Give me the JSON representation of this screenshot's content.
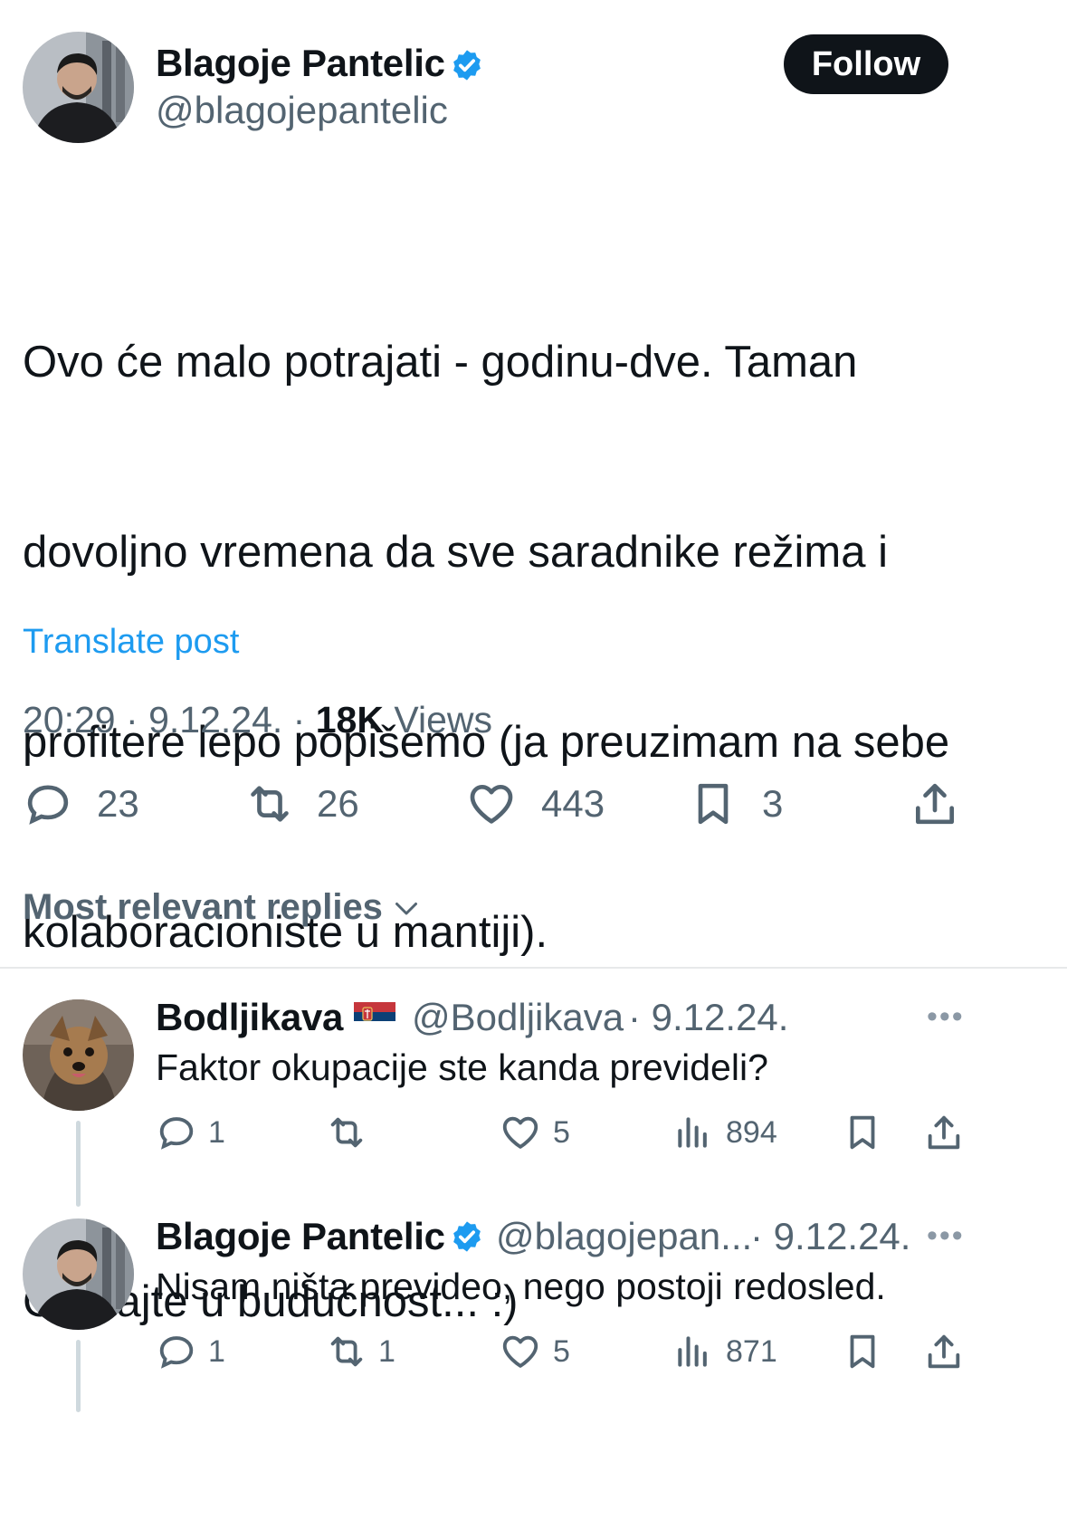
{
  "post": {
    "author": {
      "name": "Blagoje Pantelic",
      "handle": "@blagojepantelic",
      "verified": true
    },
    "follow_label": "Follow",
    "text_lines": [
      "Ovo će malo potrajati - godinu-dve. Taman",
      "dovoljno vremena da sve saradnike režima i",
      "profitere lepo popišemo (ja preuzimam na sebe",
      "kolaboracioniste u mantiji).",
      "",
      "Gledajte u budućnost... :)"
    ],
    "translate_label": "Translate post",
    "time": "20:29",
    "date": "9.12.24.",
    "views_count": "18K",
    "views_label": "Views",
    "separator": "·",
    "stats": {
      "replies": "23",
      "reposts": "26",
      "likes": "443",
      "bookmarks": "3"
    }
  },
  "replies_sort_label": "Most relevant replies",
  "replies": [
    {
      "name": "Bodljikava",
      "flag": "serbia-flag",
      "handle": "@Bodljikava",
      "date": "· 9.12.24.",
      "text": "Faktor okupacije ste kanda prevideli?",
      "stats": {
        "replies": "1",
        "reposts": "",
        "likes": "5",
        "views": "894"
      }
    },
    {
      "name": "Blagoje Pantelic",
      "verified": true,
      "handle": "@blagojepan...",
      "date": "· 9.12.24.",
      "text": "Nisam ništa prevideo, nego postoji redosled.",
      "stats": {
        "replies": "1",
        "reposts": "1",
        "likes": "5",
        "views": "871"
      }
    }
  ],
  "more_label": "•••",
  "colors": {
    "text": "#0f1419",
    "secondary": "#536471",
    "link": "#1d9bf0",
    "verified": "#1d9bf0",
    "divider": "#e7e9ea"
  },
  "icons": [
    "reply-icon",
    "repost-icon",
    "like-icon",
    "bookmark-icon",
    "share-icon",
    "views-icon",
    "verified-icon",
    "chevron-down-icon",
    "more-icon"
  ]
}
